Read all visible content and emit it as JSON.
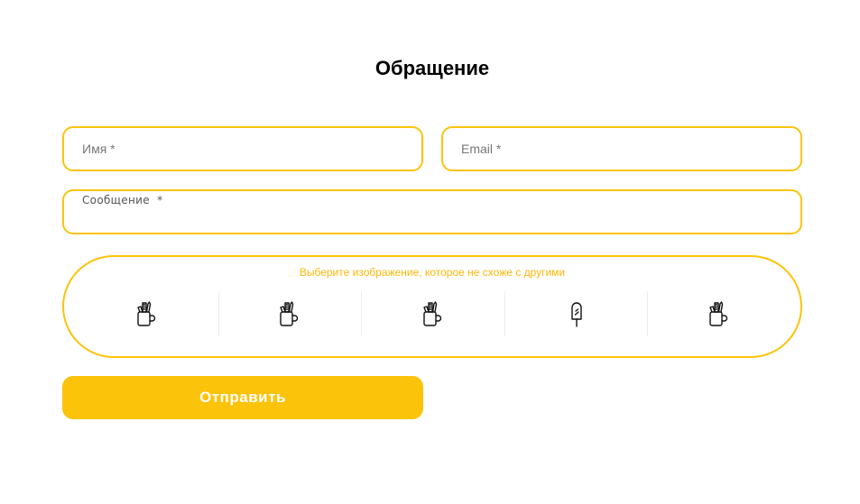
{
  "form": {
    "title": "Обращение",
    "name_placeholder": "Имя *",
    "email_placeholder": "Email *",
    "message_placeholder": "Сообщение  *",
    "captcha_prompt": "Выберите изображение, которое не схоже с другими",
    "captcha_options": [
      {
        "icon": "pencil-cup-icon"
      },
      {
        "icon": "pencil-cup-icon"
      },
      {
        "icon": "pencil-cup-icon"
      },
      {
        "icon": "popsicle-icon"
      },
      {
        "icon": "pencil-cup-icon"
      }
    ],
    "submit_label": "Отправить"
  },
  "colors": {
    "accent": "#fcc30b",
    "prompt_text": "#fcb80b",
    "title_text": "#000000",
    "button_text": "#ffffff"
  }
}
